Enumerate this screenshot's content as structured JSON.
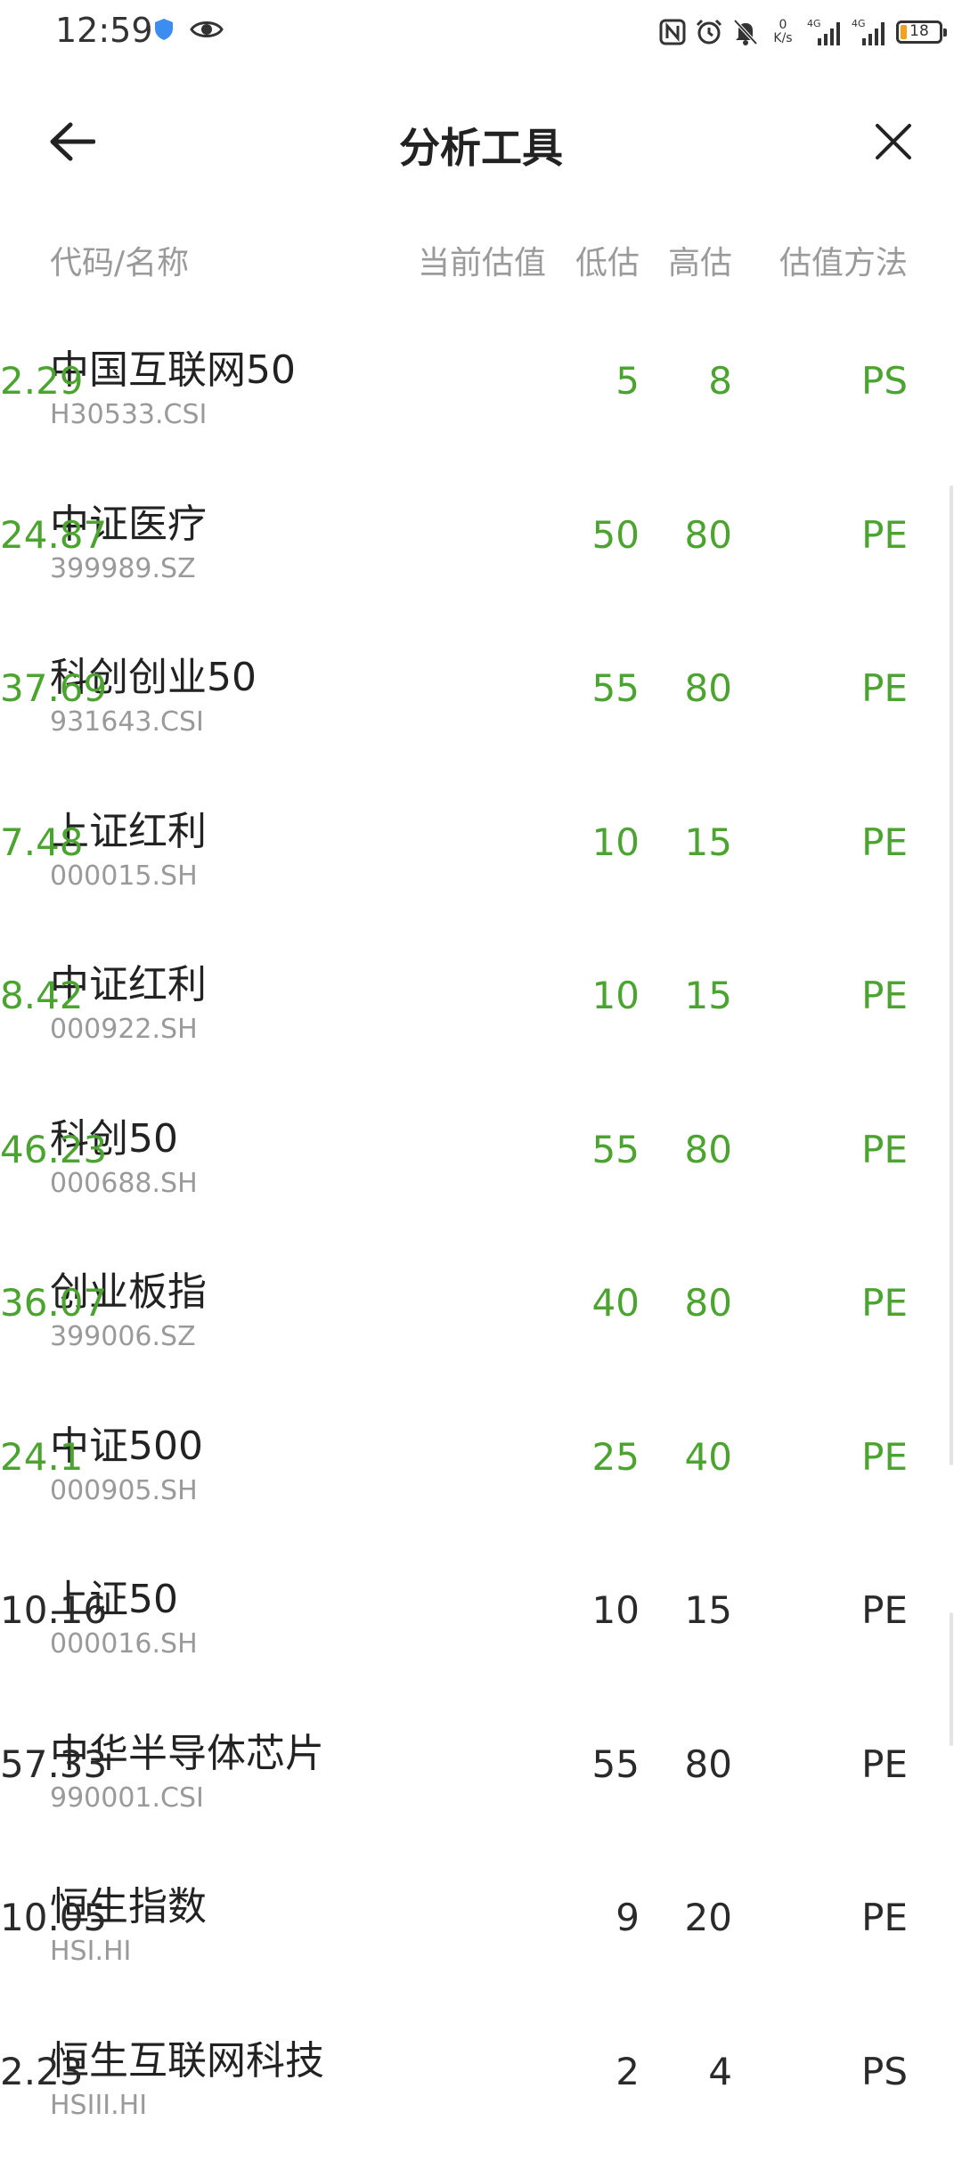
{
  "status_bar": {
    "time": "12:59",
    "net_speed_value": "0",
    "net_speed_unit": "K/s",
    "signal_1": "4G",
    "signal_2": "4G",
    "battery_level": "18",
    "icons": [
      "shield-icon",
      "eye-icon",
      "nfc-icon",
      "alarm-icon",
      "mute-icon",
      "signal-icon",
      "battery-icon"
    ]
  },
  "header": {
    "title": "分析工具",
    "back_icon": "back-arrow-icon",
    "close_icon": "close-icon"
  },
  "columns": {
    "name": "代码/名称",
    "current": "当前估值",
    "low": "低估",
    "high": "高估",
    "method": "估值方法"
  },
  "colors": {
    "green": "#4ba42f",
    "dark": "#2a2a2a",
    "muted": "#9a9a9a"
  },
  "rows": [
    {
      "name": "中国互联网50",
      "code": "H30533.CSI",
      "current": "2.29",
      "low": "5",
      "high": "8",
      "method": "PS",
      "status": "green"
    },
    {
      "name": "中证医疗",
      "code": "399989.SZ",
      "current": "24.87",
      "low": "50",
      "high": "80",
      "method": "PE",
      "status": "green"
    },
    {
      "name": "科创创业50",
      "code": "931643.CSI",
      "current": "37.69",
      "low": "55",
      "high": "80",
      "method": "PE",
      "status": "green"
    },
    {
      "name": "上证红利",
      "code": "000015.SH",
      "current": "7.48",
      "low": "10",
      "high": "15",
      "method": "PE",
      "status": "green"
    },
    {
      "name": "中证红利",
      "code": "000922.SH",
      "current": "8.42",
      "low": "10",
      "high": "15",
      "method": "PE",
      "status": "green"
    },
    {
      "name": "科创50",
      "code": "000688.SH",
      "current": "46.23",
      "low": "55",
      "high": "80",
      "method": "PE",
      "status": "green"
    },
    {
      "name": "创业板指",
      "code": "399006.SZ",
      "current": "36.07",
      "low": "40",
      "high": "80",
      "method": "PE",
      "status": "green"
    },
    {
      "name": "中证500",
      "code": "000905.SH",
      "current": "24.1",
      "low": "25",
      "high": "40",
      "method": "PE",
      "status": "green"
    },
    {
      "name": "上证50",
      "code": "000016.SH",
      "current": "10.16",
      "low": "10",
      "high": "15",
      "method": "PE",
      "status": "dark"
    },
    {
      "name": "中华半导体芯片",
      "code": "990001.CSI",
      "current": "57.33",
      "low": "55",
      "high": "80",
      "method": "PE",
      "status": "dark"
    },
    {
      "name": "恒生指数",
      "code": "HSI.HI",
      "current": "10.05",
      "low": "9",
      "high": "20",
      "method": "PE",
      "status": "dark"
    },
    {
      "name": "恒生互联网科技",
      "code": "HSIII.HI",
      "current": "2.23",
      "low": "2",
      "high": "4",
      "method": "PS",
      "status": "dark"
    }
  ]
}
